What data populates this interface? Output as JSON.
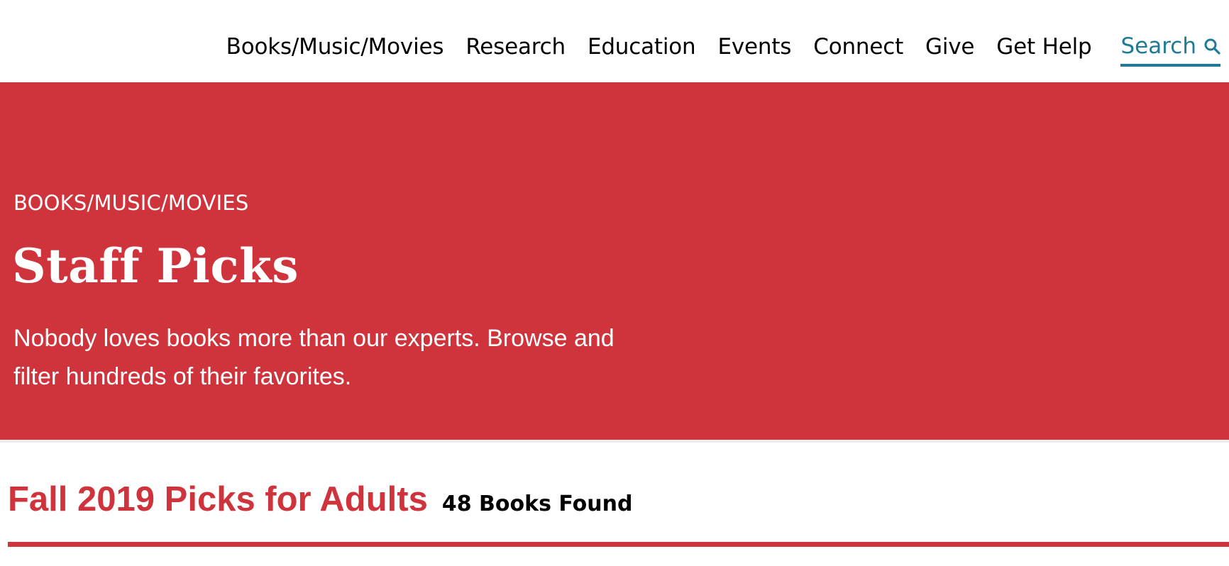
{
  "nav": {
    "items": [
      {
        "label": "Books/Music/Movies"
      },
      {
        "label": "Research"
      },
      {
        "label": "Education"
      },
      {
        "label": "Events"
      },
      {
        "label": "Connect"
      },
      {
        "label": "Give"
      },
      {
        "label": "Get Help"
      }
    ],
    "search_label": "Search",
    "search_icon": "search-icon"
  },
  "hero": {
    "eyebrow": "BOOKS/MUSIC/MOVIES",
    "title": "Staff Picks",
    "description": "Nobody loves books more than our experts. Browse and filter hundreds of their favorites."
  },
  "results": {
    "heading": "Fall 2019 Picks for Adults",
    "count": "48 Books Found"
  },
  "colors": {
    "brand_red": "#cf333b",
    "search_teal": "#1f7a96",
    "text": "#000000",
    "background": "#ffffff"
  }
}
